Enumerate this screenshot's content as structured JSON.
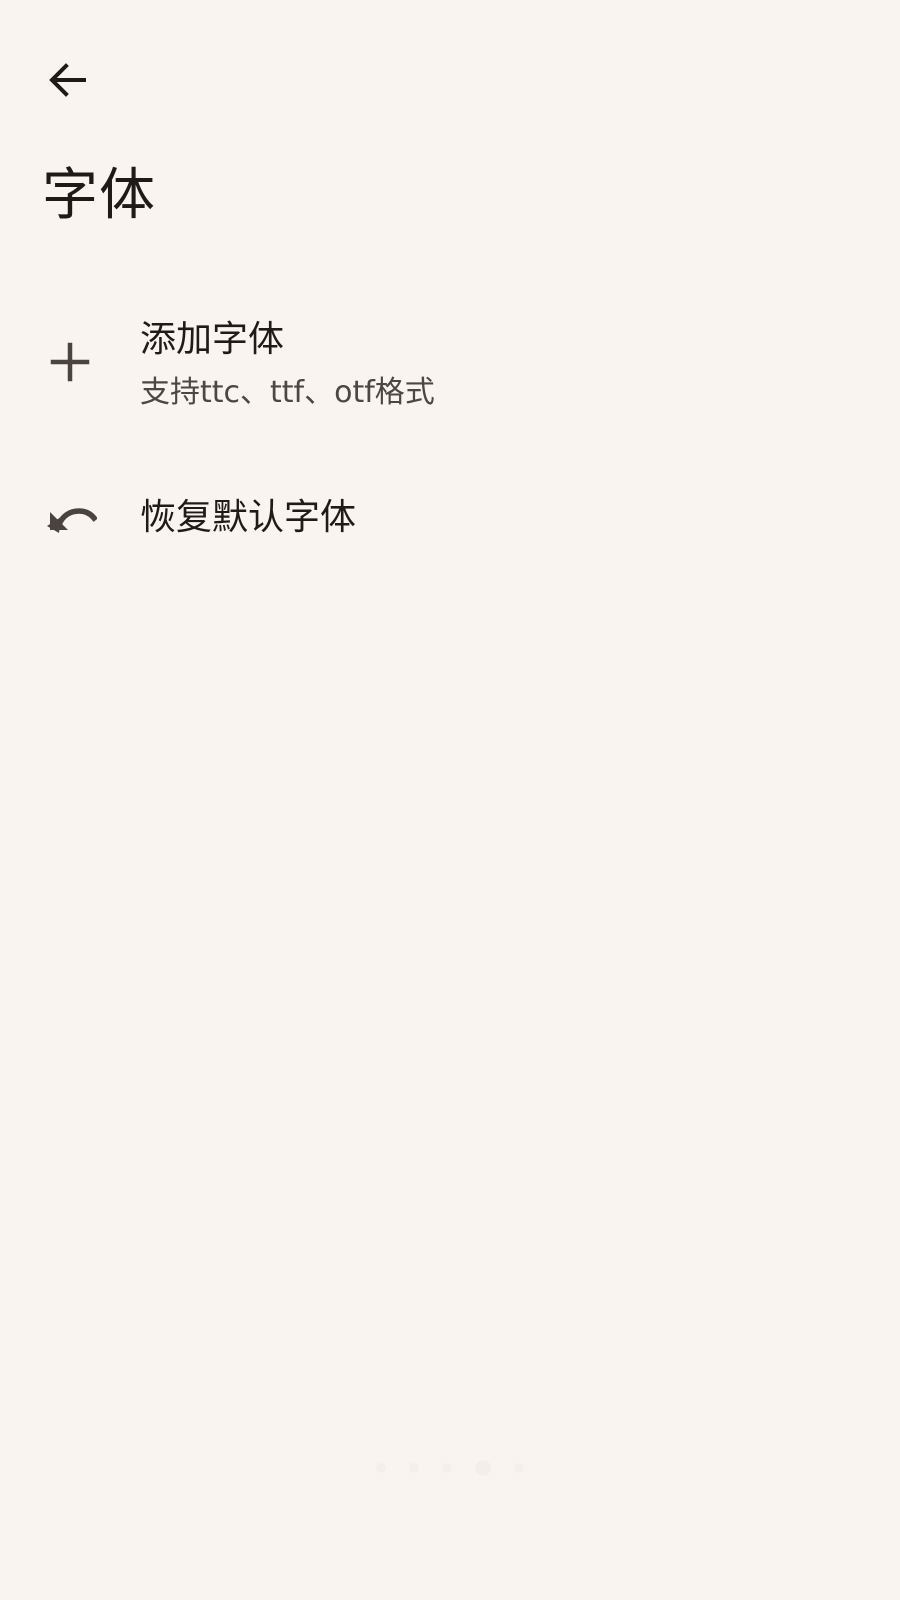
{
  "screen": {
    "title": "字体"
  },
  "navigation": {
    "back_icon": "arrow-left-icon"
  },
  "settings": {
    "items": [
      {
        "title": "添加字体",
        "subtitle": "支持ttc、ttf、otf格式",
        "icon": "plus-icon"
      },
      {
        "title": "恢复默认字体",
        "icon": "undo-icon"
      }
    ]
  },
  "page_indicator": {
    "count": 5,
    "active_index": 3
  },
  "colors": {
    "background": "#f9f4f0",
    "primary_text": "#1f1a17",
    "secondary_text": "#4e4641",
    "icon": "#4b433f"
  }
}
